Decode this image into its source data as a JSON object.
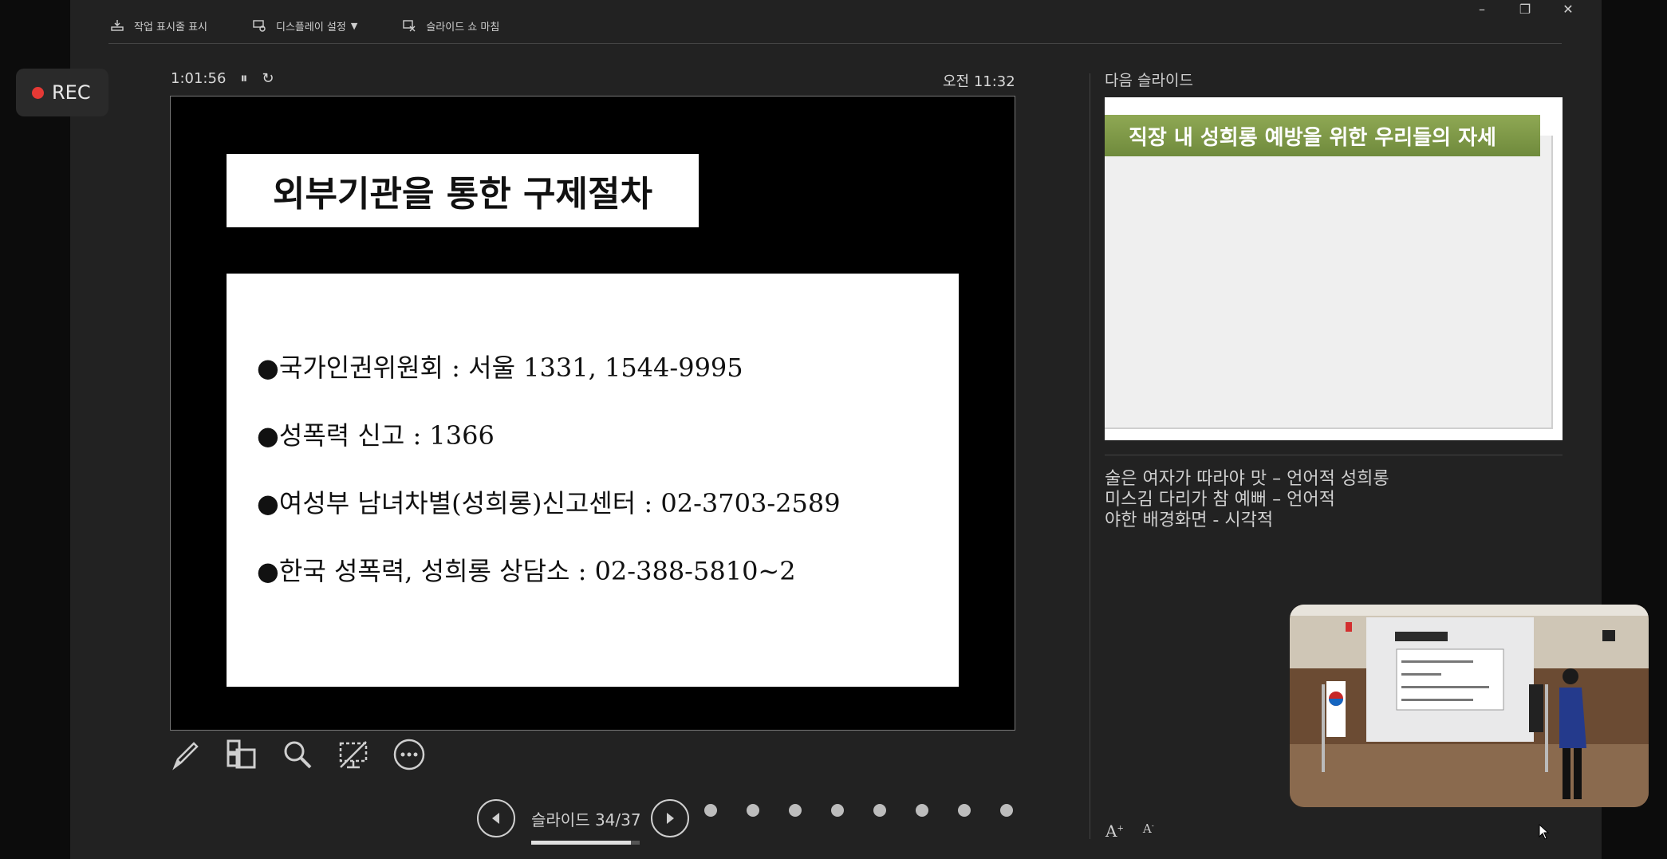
{
  "recording": {
    "label": "REC"
  },
  "toolbar": {
    "show_taskbar": "작업 표시줄 표시",
    "display_settings": "디스플레이 설정",
    "end_slideshow": "슬라이드 쇼 마침"
  },
  "presenter": {
    "elapsed_time": "1:01:56",
    "clock": "오전 11:32"
  },
  "current_slide": {
    "title": "외부기관을 통한 구제절차",
    "bullets": [
      "●국가인권위원회 : 서울 1331, 1544-9995",
      "●성폭력 신고 : 1366",
      "●여성부 남녀차별(성희롱)신고센터 : 02-3703-2589",
      "●한국 성폭력, 성희롱 상담소 : 02-388-5810~2"
    ]
  },
  "navigation": {
    "slide_counter": "슬라이드 34/37",
    "progress_fraction": 0.92
  },
  "next_slide": {
    "label": "다음 슬라이드",
    "title": "직장 내 성희롱 예방을 위한 우리들의 자세"
  },
  "notes": {
    "lines": [
      "술은 여자가 따라야 맛 – 언어적 성희롱",
      "미스김 다리가 참 예뻐 – 언어적",
      "야한 배경화면 - 시각적"
    ]
  },
  "icons": [
    "record-dot-icon",
    "taskbar-icon",
    "display-icon",
    "end-show-icon",
    "pause-icon",
    "reset-icon",
    "pen-icon",
    "see-all-slides-icon",
    "zoom-icon",
    "black-screen-icon",
    "more-options-icon",
    "previous-icon",
    "next-icon",
    "increase-font-icon",
    "decrease-font-icon"
  ],
  "colors": {
    "accent_green": "#7b9446",
    "rec_red": "#e53935"
  }
}
